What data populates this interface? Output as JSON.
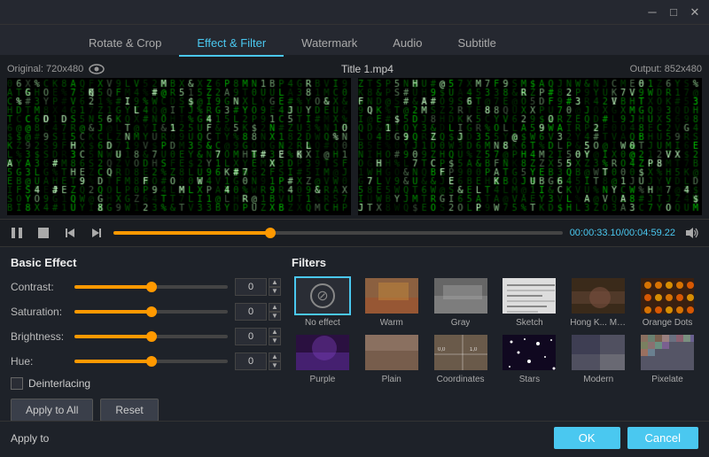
{
  "titleBar": {
    "minimizeLabel": "─",
    "maximizeLabel": "□",
    "closeLabel": "✕"
  },
  "tabs": [
    {
      "id": "rotate",
      "label": "Rotate & Crop",
      "active": false
    },
    {
      "id": "effect",
      "label": "Effect & Filter",
      "active": true
    },
    {
      "id": "watermark",
      "label": "Watermark",
      "active": false
    },
    {
      "id": "audio",
      "label": "Audio",
      "active": false
    },
    {
      "id": "subtitle",
      "label": "Subtitle",
      "active": false
    }
  ],
  "videoArea": {
    "originalLabel": "Original: 720x480",
    "outputLabel": "Output: 852x480",
    "titleLabel": "Title 1.mp4"
  },
  "controls": {
    "playLabel": "▶",
    "pauseLabel": "⏸",
    "stopLabel": "⏹",
    "prevLabel": "⏮",
    "nextLabel": "⏭",
    "timeDisplay": "00:00:33.10",
    "totalTime": "00:04:59.22",
    "progressPercent": 35
  },
  "basicEffect": {
    "title": "Basic Effect",
    "contrast": {
      "label": "Contrast:",
      "value": "0",
      "percent": 50
    },
    "saturation": {
      "label": "Saturation:",
      "value": "0",
      "percent": 50
    },
    "brightness": {
      "label": "Brightness:",
      "value": "0",
      "percent": 50
    },
    "hue": {
      "label": "Hue:",
      "value": "0",
      "percent": 50
    },
    "deinterlaceLabel": "Deinterlacing",
    "applyToAllLabel": "Apply to All",
    "resetLabel": "Reset"
  },
  "filters": {
    "title": "Filters",
    "items": [
      {
        "id": "no-effect",
        "label": "No effect",
        "selected": true,
        "type": "none"
      },
      {
        "id": "warm",
        "label": "Warm",
        "selected": false,
        "type": "warm"
      },
      {
        "id": "gray",
        "label": "Gray",
        "selected": false,
        "type": "gray"
      },
      {
        "id": "sketch",
        "label": "Sketch",
        "selected": false,
        "type": "sketch"
      },
      {
        "id": "hongkong",
        "label": "Hong K... Movie",
        "selected": false,
        "type": "hk"
      },
      {
        "id": "orange-dots",
        "label": "Orange Dots",
        "selected": false,
        "type": "orange"
      },
      {
        "id": "purple",
        "label": "Purple",
        "selected": false,
        "type": "purple"
      },
      {
        "id": "plain",
        "label": "Plain",
        "selected": false,
        "type": "plain"
      },
      {
        "id": "coordinates",
        "label": "Coordinates",
        "selected": false,
        "type": "coordinates"
      },
      {
        "id": "stars",
        "label": "Stars",
        "selected": false,
        "type": "stars"
      },
      {
        "id": "modern",
        "label": "Modern",
        "selected": false,
        "type": "modern"
      },
      {
        "id": "pixelate",
        "label": "Pixelate",
        "selected": false,
        "type": "pixelate"
      }
    ]
  },
  "footer": {
    "applyToLabel": "Apply to",
    "okLabel": "OK",
    "cancelLabel": "Cancel"
  }
}
